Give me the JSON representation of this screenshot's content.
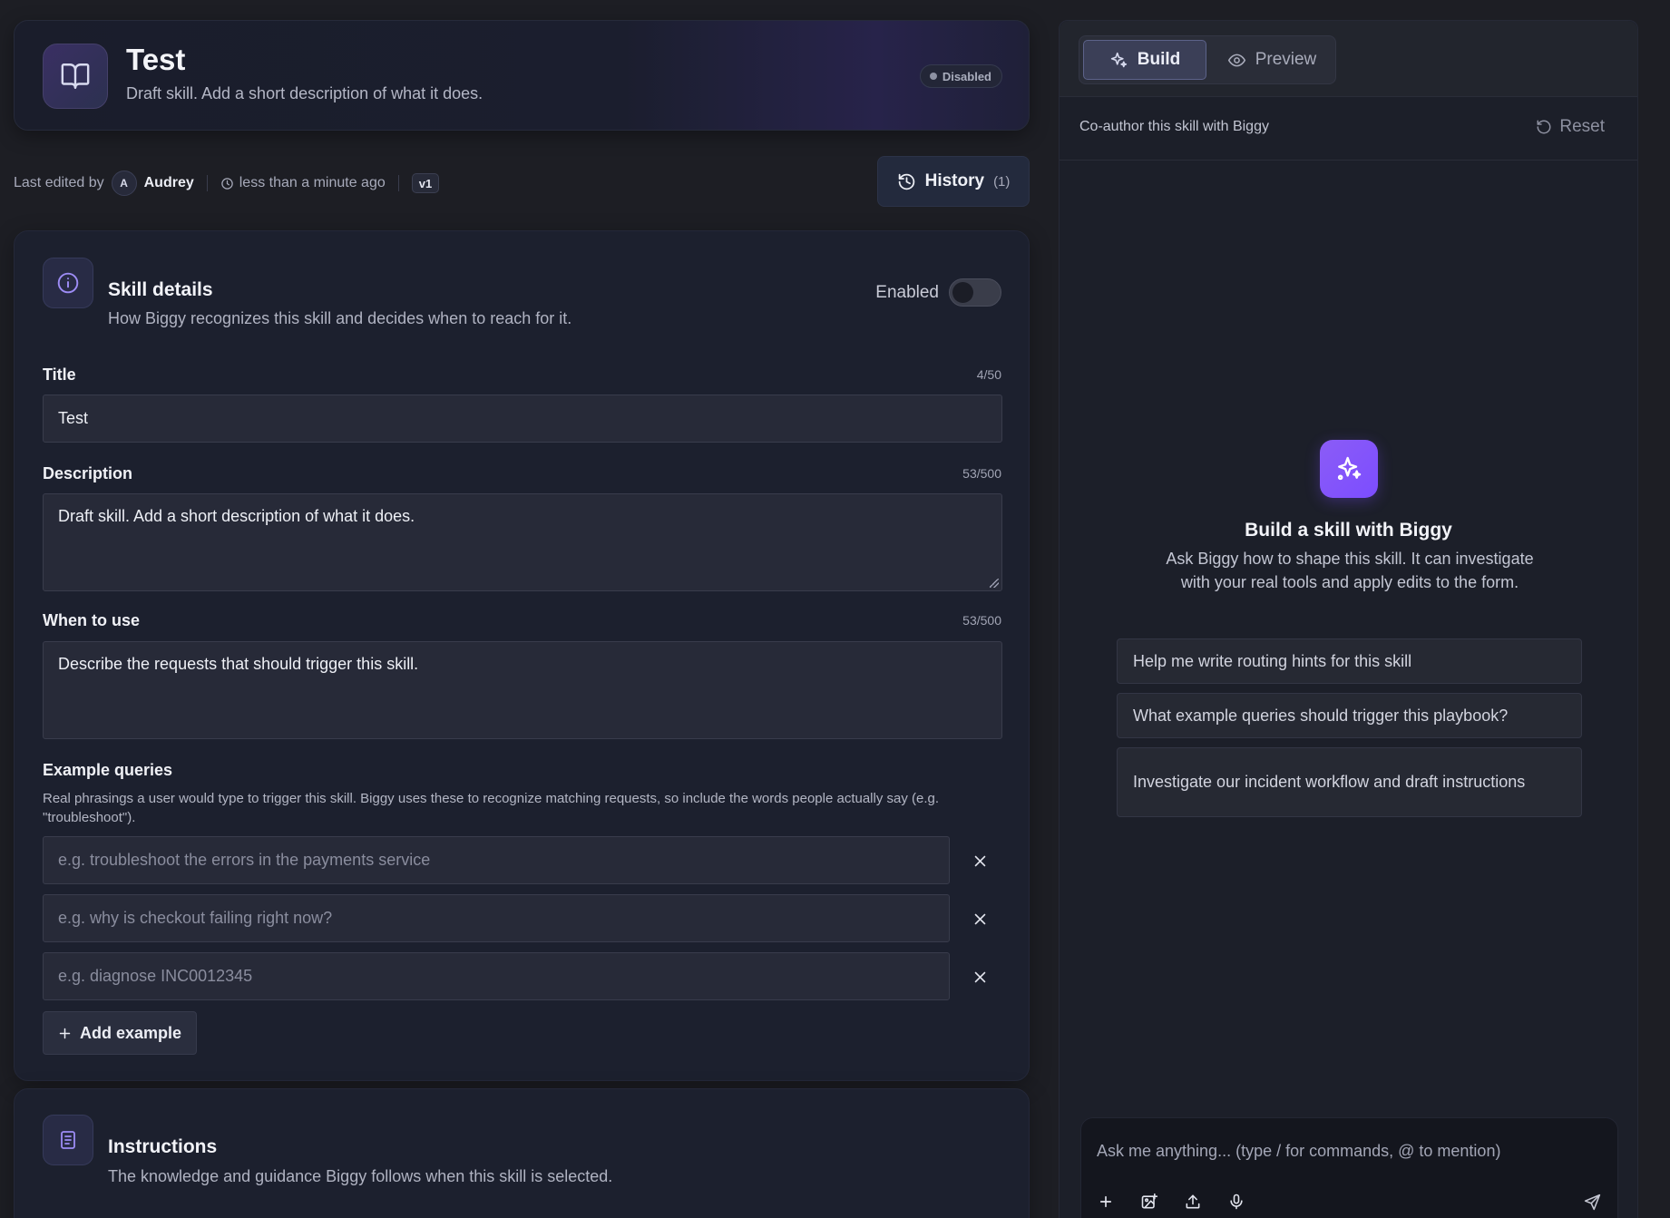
{
  "header": {
    "title": "Test",
    "subtitle": "Draft skill. Add a short description of what it does.",
    "status_badge": "Disabled",
    "icon": "book-open-icon"
  },
  "meta": {
    "edited_prefix": "Last edited by",
    "avatar_initial": "A",
    "editor_name": "Audrey",
    "time": "less than a minute ago",
    "version": "v1",
    "history_label": "History",
    "history_count": "(1)"
  },
  "details": {
    "title": "Skill details",
    "subtitle": "How Biggy recognizes this skill and decides when to reach for it.",
    "toggle_label": "Enabled",
    "toggle_on": false,
    "fields": {
      "title_label": "Title",
      "title_counter": "4/50",
      "title_value": "Test",
      "description_label": "Description",
      "description_counter": "53/500",
      "description_value": "Draft skill. Add a short description of what it does.",
      "when_label": "When to use",
      "when_counter": "53/500",
      "when_value": "Describe the requests that should trigger this skill."
    },
    "examples": {
      "label": "Example queries",
      "help": "Real phrasings a user would type to trigger this skill. Biggy uses these to recognize matching requests, so include the words people actually say (e.g. \"troubleshoot\").",
      "placeholders": [
        "e.g. troubleshoot the errors in the payments service",
        "e.g. why is checkout failing right now?",
        "e.g. diagnose INC0012345"
      ],
      "add_label": "Add example"
    }
  },
  "instructions": {
    "title": "Instructions",
    "subtitle": "The knowledge and guidance Biggy follows when this skill is selected."
  },
  "panel": {
    "tabs": {
      "build": "Build",
      "preview": "Preview"
    },
    "coauthor": "Co-author this skill with Biggy",
    "reset_label": "Reset",
    "empty": {
      "title": "Build a skill with Biggy",
      "subtitle": "Ask Biggy how to shape this skill. It can investigate with your real tools and apply edits to the form."
    },
    "suggestions": [
      "Help me write routing hints for this skill",
      "What example queries should trigger this playbook?",
      "Investigate our incident workflow and draft instructions"
    ],
    "composer_placeholder": "Ask me anything... (type / for commands, @ to mention)"
  },
  "colors": {
    "background": "#1d1e24",
    "accent": "#7c4dff",
    "card": "#1c202e"
  }
}
